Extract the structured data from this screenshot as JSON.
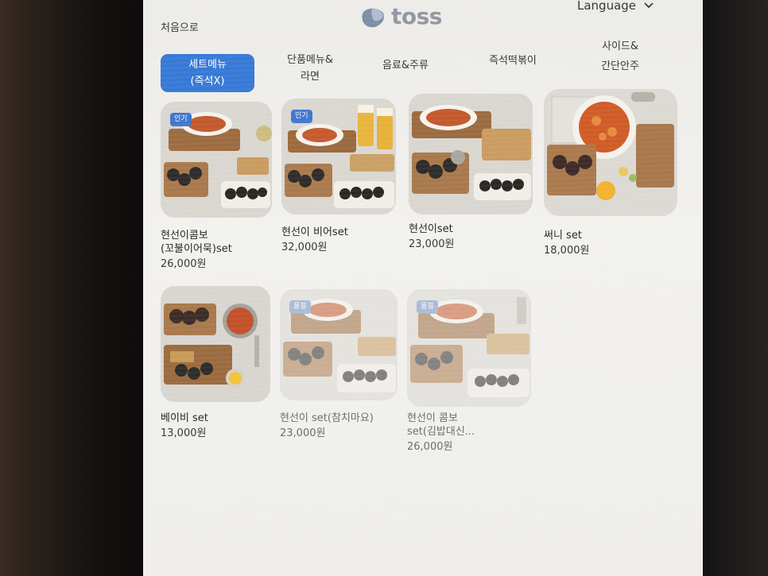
{
  "header": {
    "home_label": "처음으로",
    "brand": "toss",
    "language_label": "Language"
  },
  "tabs": [
    {
      "line1": "세트메뉴",
      "line2": "(즉석X)",
      "active": true
    },
    {
      "line1": "단품메뉴&",
      "line2": "라면",
      "active": false
    },
    {
      "line1": "음료&주류",
      "line2": "",
      "active": false
    },
    {
      "line1": "즉석떡볶이",
      "line2": "",
      "active": false
    },
    {
      "line1": "사이드&",
      "line2": "간단안주",
      "active": false
    }
  ],
  "menu_items": [
    {
      "name_line1": "현선이콤보",
      "name_line2": "(꼬불이어묵)set",
      "price": "26,000원",
      "badge": "인기",
      "sold_out": false
    },
    {
      "name_line1": "현선이 비어set",
      "name_line2": "",
      "price": "32,000원",
      "badge": "인기",
      "sold_out": false
    },
    {
      "name_line1": "현선이set",
      "name_line2": "",
      "price": "23,000원",
      "badge": "",
      "sold_out": false
    },
    {
      "name_line1": "써니 set",
      "name_line2": "",
      "price": "18,000원",
      "badge": "",
      "sold_out": false
    },
    {
      "name_line1": "베이비 set",
      "name_line2": "",
      "price": "13,000원",
      "badge": "",
      "sold_out": false
    },
    {
      "name_line1": "현선이 set(참치마요)",
      "name_line2": "",
      "price": "23,000원",
      "badge": "품절",
      "sold_out": true
    },
    {
      "name_line1": "현선이 콤보",
      "name_line2": "set(김밥대신...",
      "price": "26,000원",
      "badge": "품절",
      "sold_out": true
    }
  ],
  "colors": {
    "accent": "#3478d6",
    "badge": "#3e74cc",
    "brand_gray": "#8f969d"
  }
}
